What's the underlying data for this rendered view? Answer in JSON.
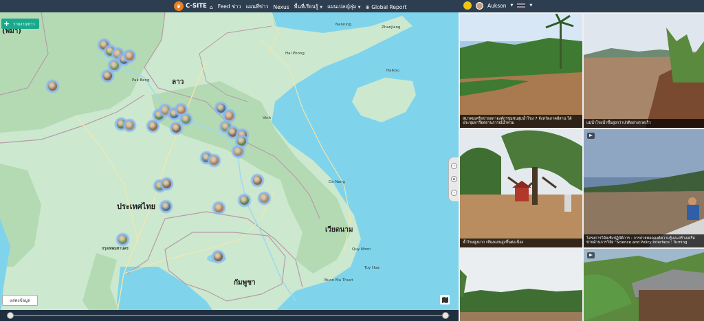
{
  "navbar": {
    "brand": "C-SITE",
    "items": [
      {
        "label": "Feed ข่าว",
        "dropdown": false
      },
      {
        "label": "แผนที่ข่าว",
        "dropdown": false
      },
      {
        "label": "Nexus",
        "dropdown": false
      },
      {
        "label": "พื้นที่เรียนรู้",
        "dropdown": true
      },
      {
        "label": "แผนเปลญ์ลุ่ม",
        "dropdown": true
      },
      {
        "label": "Global Report",
        "dropdown": false
      }
    ],
    "user": "Aukson",
    "language_flag": "thai-flag"
  },
  "map": {
    "add_news_label": "รายงานข่าว",
    "show_data_label": "แสดงข้อมูล",
    "labels": [
      {
        "text": "(พม่า)",
        "kind": "country"
      },
      {
        "text": "ลาว",
        "kind": "country"
      },
      {
        "text": "ประเทศไทย",
        "kind": "country"
      },
      {
        "text": "เวียดนาม",
        "kind": "country"
      },
      {
        "text": "กัมพูชา",
        "kind": "country"
      },
      {
        "text": "Zhanjiang",
        "kind": "city"
      },
      {
        "text": "Haikou",
        "kind": "city"
      },
      {
        "text": "Hai Phong",
        "kind": "city"
      },
      {
        "text": "Nanning",
        "kind": "city"
      },
      {
        "text": "Pak Beng",
        "kind": "city"
      },
      {
        "text": "Vinh",
        "kind": "city"
      },
      {
        "text": "Da Nang",
        "kind": "city"
      },
      {
        "text": "Quy Nhon",
        "kind": "city"
      },
      {
        "text": "Buon Ma Thuot",
        "kind": "city"
      },
      {
        "text": "Tuy Hoa",
        "kind": "city"
      },
      {
        "text": "กรุงเทพมหานคร",
        "kind": "city"
      }
    ]
  },
  "gallery": [
    {
      "caption": "สมาคมเครือข่ายสภาองค์กรชุมชนลุ่มน้ำโขง 7 จังหวัดภาคอีสาน ได้ประชุมหารือสถานการณ์น้ำท่วม",
      "video": false
    },
    {
      "caption": "แม่น้ำโขงน้ำขึ้นสูงกว่าปกติอย่างรวดเร็ว",
      "video": false
    },
    {
      "caption": "น้ำโขงสูงมาก เชียงแสนสูงขึ้นต่อเนื่อง",
      "video": false
    },
    {
      "caption": "โครงการวิจัยเชิงปฏิบัติการ : การถ่ายทอดองค์ความรู้และสร้างเครือข่ายด้านการวิจัย \"Science and Policy Interface : Turning",
      "video": true
    },
    {
      "caption": "",
      "video": false
    },
    {
      "caption": "",
      "video": true
    }
  ]
}
